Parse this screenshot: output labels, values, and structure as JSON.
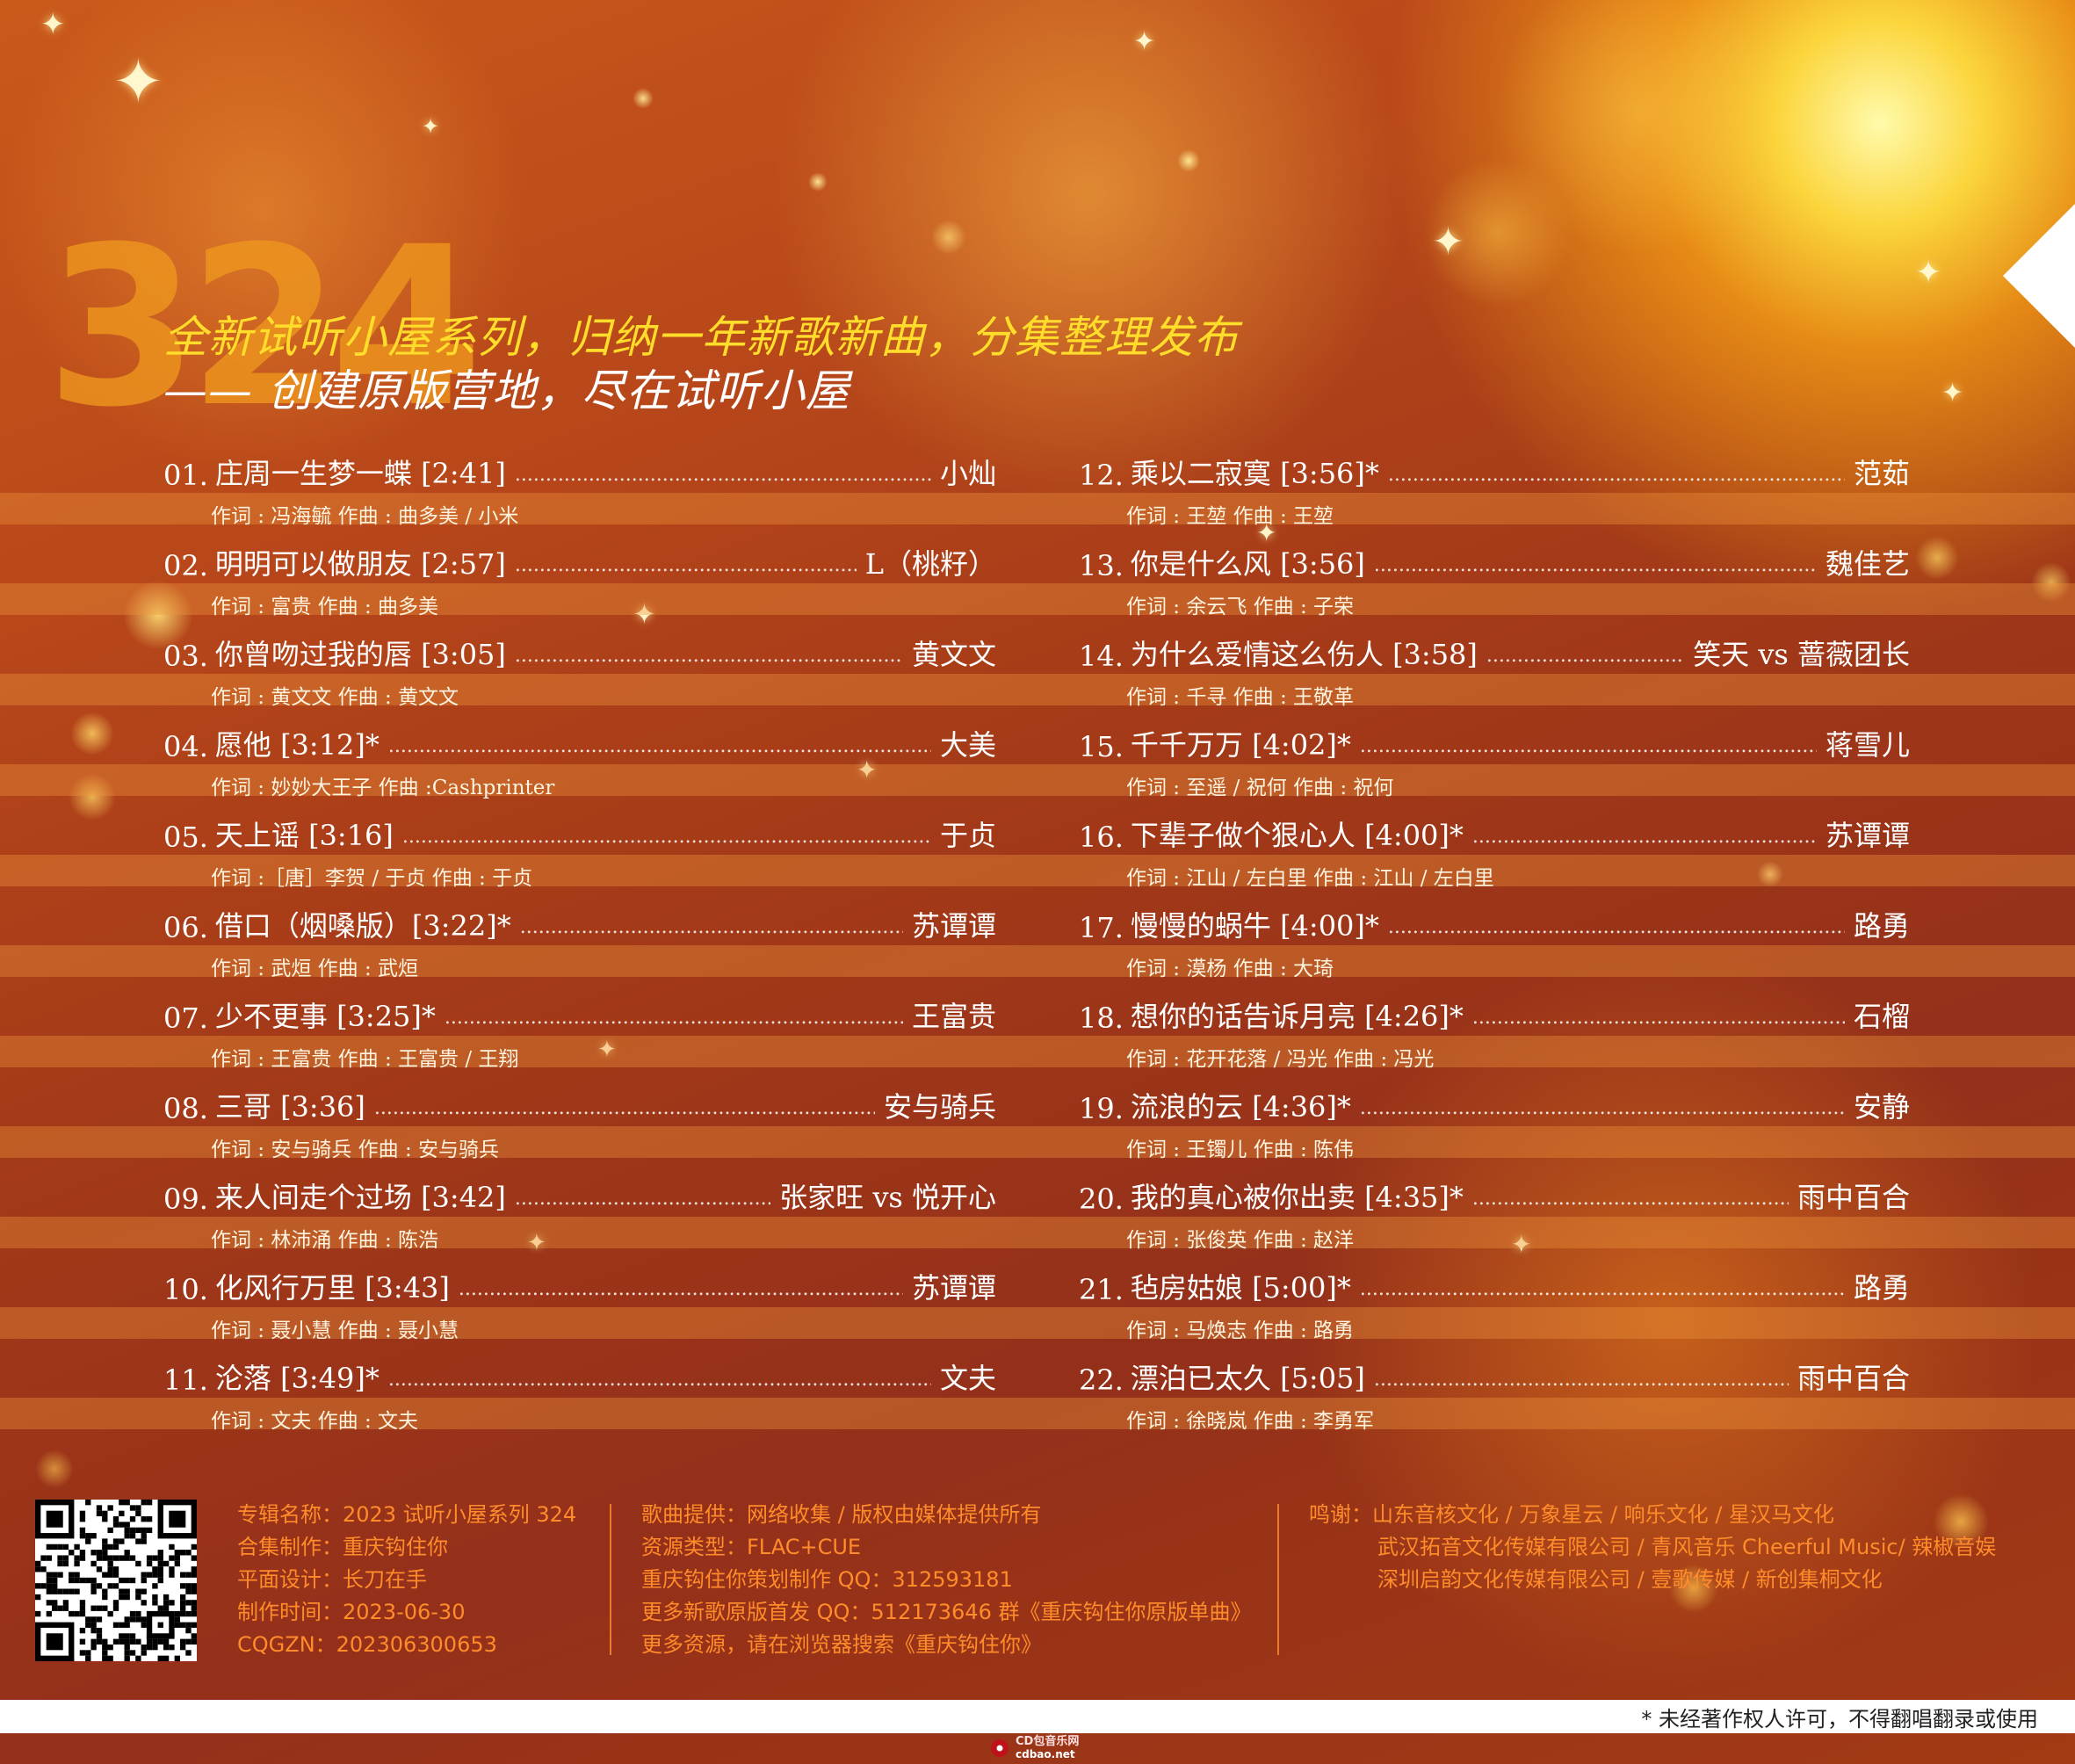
{
  "header": {
    "series_number": "324",
    "tagline_1": "全新试听小屋系列，归纳一年新歌新曲，分集整理发布",
    "tagline_2": "—— 创建原版营地，尽在试听小屋"
  },
  "tracks": [
    {
      "num": "01.",
      "title": "庄周一生梦一蝶 [2:41]",
      "artist": "小灿",
      "credit": "作词 : 冯海毓  作曲 : 曲多美 / 小米"
    },
    {
      "num": "02.",
      "title": "明明可以做朋友 [2:57]",
      "artist": "L（桃籽）",
      "credit": "作词 : 富贵  作曲 : 曲多美"
    },
    {
      "num": "03.",
      "title": "你曾吻过我的唇 [3:05]",
      "artist": "黄文文",
      "credit": "作词 : 黄文文  作曲 : 黄文文"
    },
    {
      "num": "04.",
      "title": "愿他 [3:12]*",
      "artist": "大美",
      "credit": "作词 : 妙妙大王子  作曲 :Cashprinter"
    },
    {
      "num": "05.",
      "title": "天上谣 [3:16]",
      "artist": "于贞",
      "credit": "作词 :［唐］李贺 / 于贞  作曲 : 于贞"
    },
    {
      "num": "06.",
      "title": "借口（烟嗓版）[3:22]*",
      "artist": "苏谭谭",
      "credit": "作词 : 武烜  作曲 : 武烜"
    },
    {
      "num": "07.",
      "title": "少不更事 [3:25]*",
      "artist": "王富贵",
      "credit": "作词 : 王富贵  作曲 : 王富贵 / 王翔"
    },
    {
      "num": "08.",
      "title": "三哥 [3:36]",
      "artist": "安与骑兵",
      "credit": "作词 : 安与骑兵  作曲 : 安与骑兵"
    },
    {
      "num": "09.",
      "title": "来人间走个过场 [3:42]",
      "artist": "张家旺 vs 悦开心",
      "credit": "作词 : 林沛涌  作曲 : 陈浩"
    },
    {
      "num": "10.",
      "title": "化风行万里 [3:43]",
      "artist": "苏谭谭",
      "credit": "作词 : 聂小慧  作曲 : 聂小慧"
    },
    {
      "num": "11.",
      "title": "沦落 [3:49]*",
      "artist": "文夫",
      "credit": "作词 : 文夫  作曲 : 文夫"
    },
    {
      "num": "12.",
      "title": "乘以二寂寞 [3:56]*",
      "artist": "范茹",
      "credit": "作词 : 王堃  作曲 : 王堃"
    },
    {
      "num": "13.",
      "title": "你是什么风 [3:56]",
      "artist": "魏佳艺",
      "credit": "作词 : 余云飞  作曲 : 子荣"
    },
    {
      "num": "14.",
      "title": "为什么爱情这么伤人 [3:58]",
      "artist": "笑天 vs 蔷薇团长",
      "credit": "作词 : 千寻  作曲 : 王敬革"
    },
    {
      "num": "15.",
      "title": "千千万万 [4:02]*",
      "artist": "蒋雪儿",
      "credit": "作词 : 至遥 / 祝何  作曲 : 祝何"
    },
    {
      "num": "16.",
      "title": "下辈子做个狠心人 [4:00]*",
      "artist": "苏谭谭",
      "credit": "作词 : 江山 / 左白里  作曲 : 江山 / 左白里"
    },
    {
      "num": "17.",
      "title": "慢慢的蜗牛 [4:00]*",
      "artist": "路勇",
      "credit": "作词 : 漠杨  作曲 : 大琦"
    },
    {
      "num": "18.",
      "title": "想你的话告诉月亮 [4:26]*",
      "artist": "石榴",
      "credit": "作词 : 花开花落 / 冯光  作曲 : 冯光"
    },
    {
      "num": "19.",
      "title": "流浪的云 [4:36]*",
      "artist": "安静",
      "credit": "作词 : 王镯儿  作曲 : 陈伟"
    },
    {
      "num": "20.",
      "title": "我的真心被你出卖 [4:35]*",
      "artist": "雨中百合",
      "credit": "作词 : 张俊英  作曲 : 赵洋"
    },
    {
      "num": "21.",
      "title": "毡房姑娘 [5:00]*",
      "artist": "路勇",
      "credit": "作词 : 马焕志  作曲 : 路勇"
    },
    {
      "num": "22.",
      "title": "漂泊已太久 [5:05]",
      "artist": "雨中百合",
      "credit": "作词 : 徐晓岚  作曲 : 李勇军"
    }
  ],
  "footer": {
    "col1": [
      "专辑名称：2023 试听小屋系列 324",
      "合集制作：重庆钩住你",
      "平面设计：长刀在手",
      "制作时间：2023-06-30",
      "CQGZN：202306300653"
    ],
    "col2": [
      "歌曲提供：网络收集 / 版权由媒体提供所有",
      "资源类型：FLAC+CUE",
      "重庆钩住你策划制作 QQ：312593181",
      "更多新歌原版首发 QQ：512173646 群《重庆钩住你原版单曲》",
      "更多资源，请在浏览器搜索《重庆钩住你》"
    ],
    "col3": [
      "鸣谢：山东音核文化 / 万象星云 / 响乐文化 / 星汉马文化",
      "武汉拓音文化传媒有限公司 / 青风音乐 Cheerful Music/ 辣椒音娱",
      "深圳启韵文化传媒有限公司 / 壹歌传媒 / 新创集桐文化"
    ]
  },
  "bottom_note": "* 未经著作权人许可，不得翻唱翻录或使用",
  "watermark": {
    "line1": "CD包音乐网",
    "line2": "cdbao.net"
  },
  "colors": {
    "title_yellow": "#ffdd2a",
    "footer_orange": "#ff8c2a",
    "background": "#a43a18"
  }
}
